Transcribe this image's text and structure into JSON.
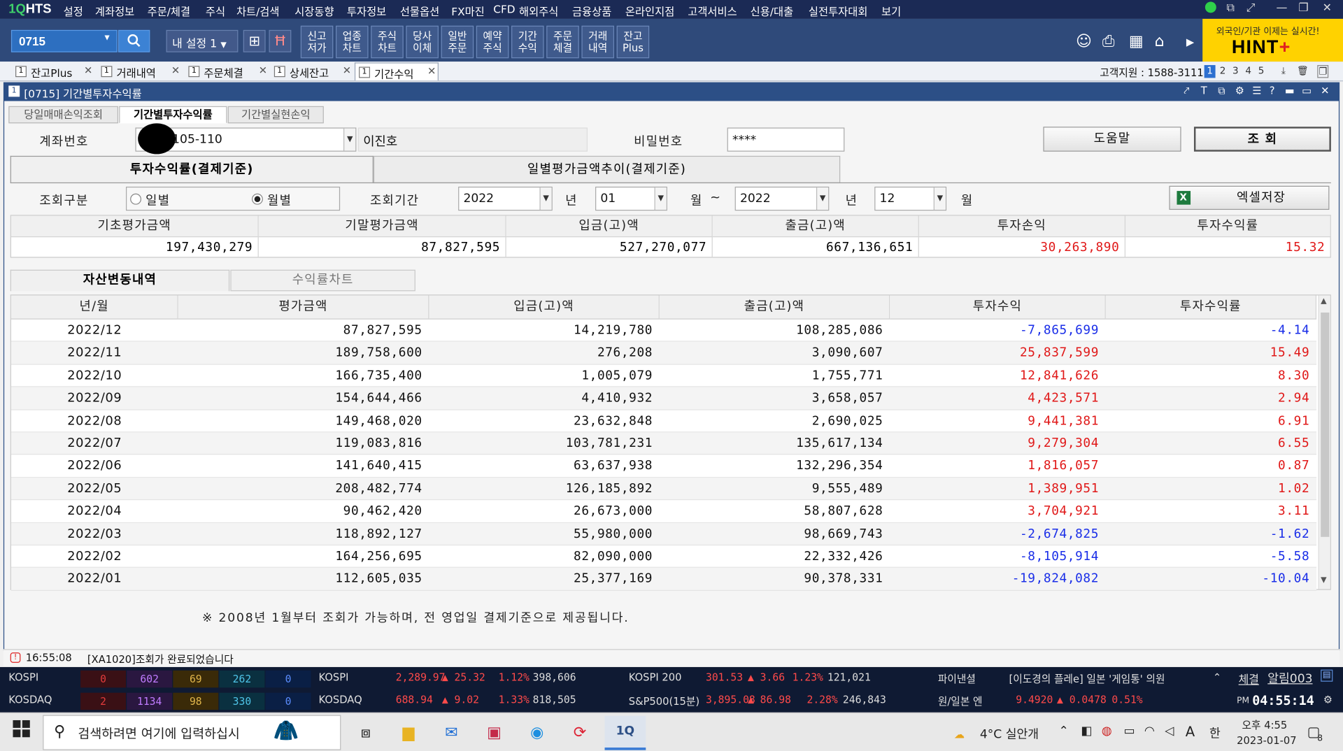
{
  "app": {
    "logo_a": "1Q",
    "logo_b": "HTS",
    "menu": [
      "설정",
      "계좌정보",
      "주문/체결",
      "주식",
      "차트/검색",
      "시장동향",
      "투자정보",
      "선물옵션",
      "FX마진",
      "CFD",
      "해외주식",
      "금융상품",
      "온라인지점",
      "고객서비스",
      "신용/대출",
      "실전투자대회",
      "보기"
    ]
  },
  "toolbar": {
    "screen_no": "0715",
    "my_setting": "내 설정 1",
    "buttons": [
      "신고\n저가",
      "업종\n차트",
      "주식\n차트",
      "당사\n이체",
      "일반\n주문",
      "예약\n주식",
      "기간\n수익",
      "주문\n체결",
      "거래\n내역",
      "잔고\nPlus"
    ],
    "hint_top": "외국인/기관 이제는 실시간!",
    "hint_main": "HINT",
    "hint_plus": "+"
  },
  "tabs": [
    {
      "label": "잔고Plus"
    },
    {
      "label": "거래내역"
    },
    {
      "label": "주문체결"
    },
    {
      "label": "상세잔고"
    },
    {
      "label": "기간수익"
    }
  ],
  "customer_support": "고객지원 : 1588-3111",
  "page_numbers": [
    "1",
    "2",
    "3",
    "4",
    "5"
  ],
  "window": {
    "title": "[0715] 기간별투자수익률",
    "sub_tabs": [
      "당일매매손익조회",
      "기간별투자수익률",
      "기간별실현손익"
    ]
  },
  "form": {
    "account_label": "계좌번호",
    "account_value": "105-110",
    "account_name": "이진호",
    "password_label": "비밀번호",
    "password_value": "****",
    "help_button": "도움말",
    "query_button": "조 회",
    "tab_return": "투자수익률(결제기준)",
    "tab_daily": "일별평가금액추이(결제기준)",
    "query_type_label": "조회구분",
    "radio_daily": "일별",
    "radio_monthly": "월별",
    "period_label": "조회기간",
    "from_year": "2022",
    "year_unit": "년",
    "from_month": "01",
    "month_unit": "월",
    "tilde": "~",
    "to_year": "2022",
    "to_month": "12",
    "excel_button": "엑셀저장"
  },
  "summary": {
    "headers": [
      "기초평가금액",
      "기말평가금액",
      "입금(고)액",
      "출금(고)액",
      "투자손익",
      "투자수익률"
    ],
    "values": [
      "197,430,279",
      "87,827,595",
      "527,270,077",
      "667,136,651",
      "30,263,890",
      "15.32"
    ]
  },
  "section_tabs": {
    "active": "자산변동내역",
    "inactive": "수익률차트"
  },
  "grid": {
    "headers": [
      "년/월",
      "평가금액",
      "입금(고)액",
      "출금(고)액",
      "투자수익",
      "투자수익률"
    ],
    "rows": [
      [
        "2022/12",
        "87,827,595",
        "14,219,780",
        "108,285,086",
        "-7,865,699",
        "-4.14"
      ],
      [
        "2022/11",
        "189,758,600",
        "276,208",
        "3,090,607",
        "25,837,599",
        "15.49"
      ],
      [
        "2022/10",
        "166,735,400",
        "1,005,079",
        "1,755,771",
        "12,841,626",
        "8.30"
      ],
      [
        "2022/09",
        "154,644,466",
        "4,410,932",
        "3,658,057",
        "4,423,571",
        "2.94"
      ],
      [
        "2022/08",
        "149,468,020",
        "23,632,848",
        "2,690,025",
        "9,441,381",
        "6.91"
      ],
      [
        "2022/07",
        "119,083,816",
        "103,781,231",
        "135,617,134",
        "9,279,304",
        "6.55"
      ],
      [
        "2022/06",
        "141,640,415",
        "63,637,938",
        "132,296,354",
        "1,816,057",
        "0.87"
      ],
      [
        "2022/05",
        "208,482,774",
        "126,185,892",
        "9,555,489",
        "1,389,951",
        "1.02"
      ],
      [
        "2022/04",
        "90,462,420",
        "26,673,000",
        "58,807,628",
        "3,704,921",
        "3.11"
      ],
      [
        "2022/03",
        "118,892,127",
        "55,980,000",
        "98,669,743",
        "-2,674,825",
        "-1.62"
      ],
      [
        "2022/02",
        "164,256,695",
        "82,090,000",
        "22,332,426",
        "-8,105,914",
        "-5.58"
      ],
      [
        "2022/01",
        "112,605,035",
        "25,377,169",
        "90,378,331",
        "-19,824,082",
        "-10.04"
      ]
    ]
  },
  "note": "※ 2008년 1월부터 조회가 가능하며, 전 영업일 결제기준으로 제공됩니다.",
  "status": {
    "time": "16:55:08",
    "message": "[XA1020]조회가 완료되었습니다"
  },
  "ticker": {
    "kospi_label": "KOSPI",
    "kosdaq_label": "KOSDAQ",
    "kospi_breadth": [
      "0",
      "602",
      "69",
      "262",
      "0"
    ],
    "kosdaq_breadth": [
      "2",
      "1134",
      "98",
      "330",
      "0"
    ],
    "kospi_index": {
      "label": "KOSPI",
      "value": "2,289.97",
      "change": "▲ 25.32",
      "pct": "1.12%",
      "volume": "398,606"
    },
    "kosdaq_index": {
      "label": "KOSDAQ",
      "value": "688.94",
      "change": "▲ 9.02",
      "pct": "1.33%",
      "volume": "818,505"
    },
    "kospi200": {
      "label": "KOSPI 200",
      "value": "301.53",
      "change": "▲ 3.66",
      "pct": "1.23%",
      "volume": "121,021"
    },
    "sp500": {
      "label": "S&P500(15분)",
      "value": "3,895.08",
      "change": "▲ 86.98",
      "pct": "2.28%",
      "volume": "246,843"
    },
    "news_label": "파이낸셜",
    "news_text": "[이도경의 플레e] 일본 '게임통' 의원",
    "fx_label": "원/일본 엔",
    "fx_value": "9.4920",
    "fx_change": "▲ 0.0478",
    "fx_pct": "0.51%",
    "btn_trade": "체결",
    "btn_alert": "알림003",
    "clock_ampm": "PM",
    "clock": "04:55:14"
  },
  "taskbar": {
    "search_placeholder": "검색하려면 여기에 입력하십시",
    "weather": "4°C 실안개",
    "ime": "한",
    "time": "오후 4:55",
    "date": "2023-01-07",
    "notif_count": "8"
  },
  "colors": {
    "negative": "#1a2ee8",
    "positive": "#e01818",
    "title_bar": "#2c4f86"
  }
}
